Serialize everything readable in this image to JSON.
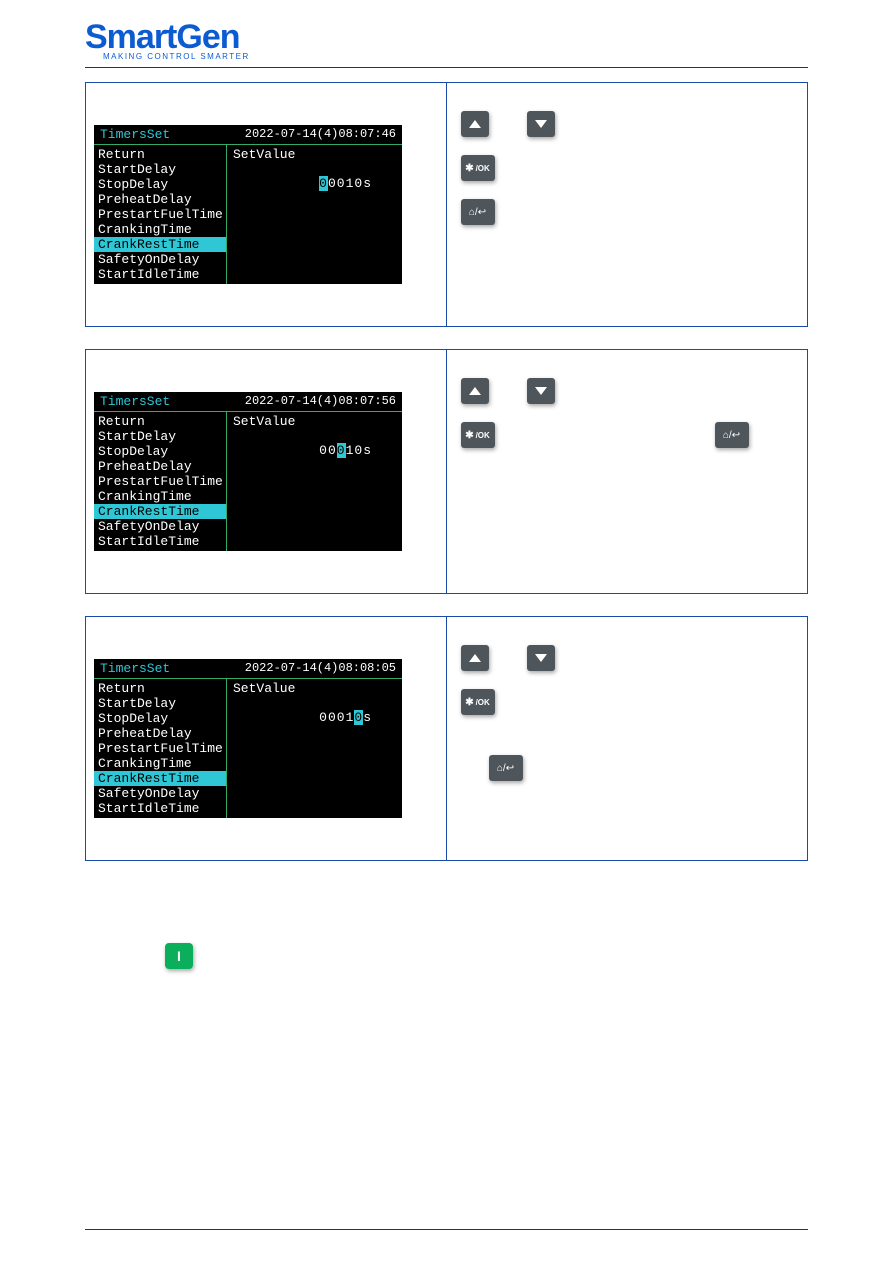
{
  "header": {
    "logo_main": "SmartGen",
    "tagline": "MAKING CONTROL SMARTER"
  },
  "screens": [
    {
      "title": "TimersSet",
      "timestamp": "2022-07-14(4)08:07:46",
      "menu": [
        "Return",
        "StartDelay",
        "StopDelay",
        "PreheatDelay",
        "PrestartFuelTime",
        "CrankingTime",
        "CrankRestTime",
        "SafetyOnDelay",
        "StartIdleTime"
      ],
      "selected": "CrankRestTime",
      "setvalue_label": "SetValue",
      "value_chars": [
        "0",
        "0",
        "0",
        "1",
        "0",
        "s"
      ],
      "highlight_index": 0
    },
    {
      "title": "TimersSet",
      "timestamp": "2022-07-14(4)08:07:56",
      "menu": [
        "Return",
        "StartDelay",
        "StopDelay",
        "PreheatDelay",
        "PrestartFuelTime",
        "CrankingTime",
        "CrankRestTime",
        "SafetyOnDelay",
        "StartIdleTime"
      ],
      "selected": "CrankRestTime",
      "setvalue_label": "SetValue",
      "value_chars": [
        "0",
        "0",
        "0",
        "1",
        "0",
        "s"
      ],
      "highlight_index": 2
    },
    {
      "title": "TimersSet",
      "timestamp": "2022-07-14(4)08:08:05",
      "menu": [
        "Return",
        "StartDelay",
        "StopDelay",
        "PreheatDelay",
        "PrestartFuelTime",
        "CrankingTime",
        "CrankRestTime",
        "SafetyOnDelay",
        "StartIdleTime"
      ],
      "selected": "CrankRestTime",
      "setvalue_label": "SetValue",
      "value_chars": [
        "0",
        "0",
        "0",
        "1",
        "0",
        "s"
      ],
      "highlight_index": 4
    }
  ],
  "buttons": {
    "ok_label": "/OK",
    "home_label": "⌂/↩"
  },
  "green_button_label": "I"
}
